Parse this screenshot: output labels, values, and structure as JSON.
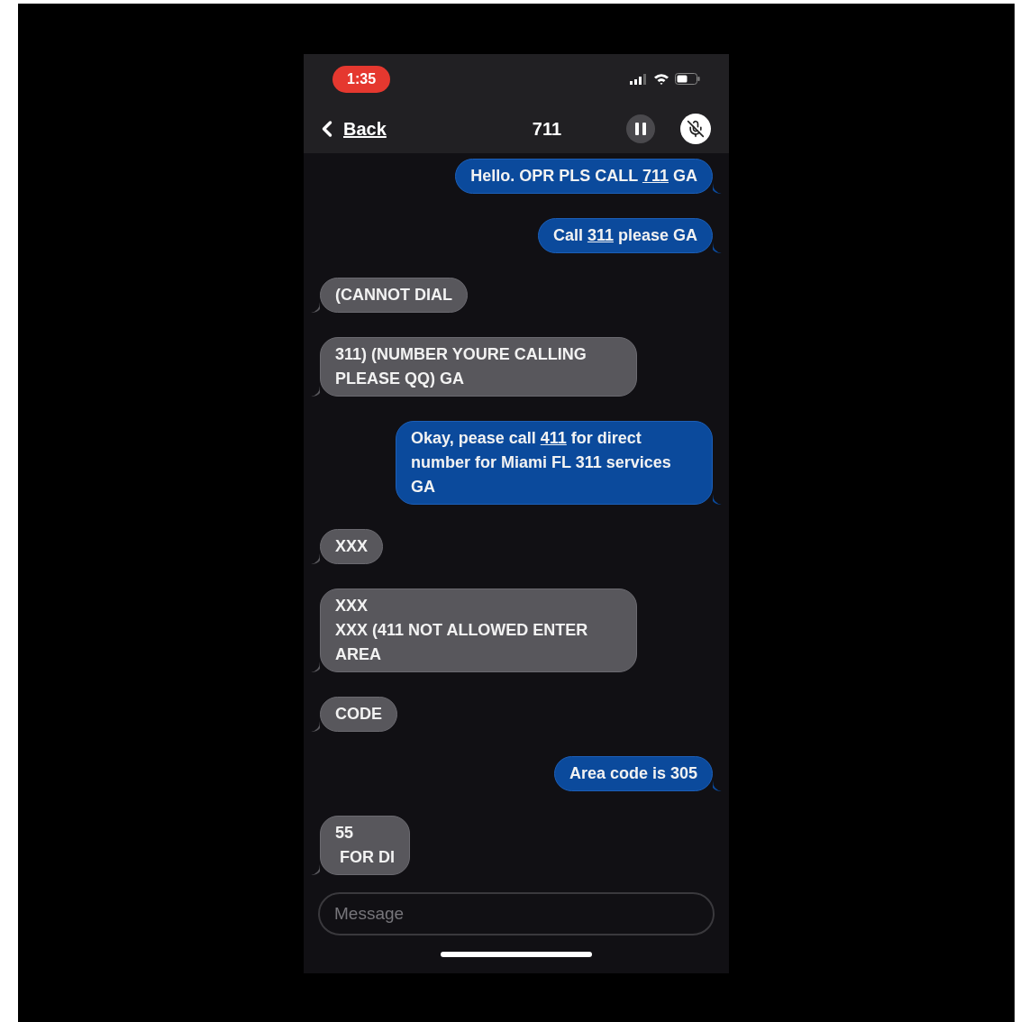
{
  "status_bar": {
    "time": "1:35"
  },
  "nav": {
    "back": "Back",
    "title": "711"
  },
  "messages": [
    {
      "kind": "sent",
      "parts": [
        {
          "text": "Hello. OPR PLS CALL ",
          "link": false
        },
        {
          "text": "711",
          "link": true
        },
        {
          "text": " GA",
          "link": false
        }
      ]
    },
    {
      "kind": "sent",
      "parts": [
        {
          "text": "Call ",
          "link": false
        },
        {
          "text": "311",
          "link": true
        },
        {
          "text": " please GA",
          "link": false
        }
      ]
    },
    {
      "kind": "received",
      "parts": [
        {
          "text": "(CANNOT DIAL",
          "link": false
        }
      ]
    },
    {
      "kind": "received",
      "parts": [
        {
          "text": "311) (NUMBER YOURE CALLING PLEASE QQ) GA",
          "link": false
        }
      ]
    },
    {
      "kind": "sent",
      "parts": [
        {
          "text": "Okay, pease call ",
          "link": false
        },
        {
          "text": "411",
          "link": true
        },
        {
          "text": " for direct number for Miami FL 311 services GA",
          "link": false
        }
      ]
    },
    {
      "kind": "received",
      "parts": [
        {
          "text": "XXX",
          "link": false
        }
      ]
    },
    {
      "kind": "received",
      "parts": [
        {
          "text": "XXX\nXXX (411 NOT ALLOWED ENTER AREA",
          "link": false
        }
      ]
    },
    {
      "kind": "received",
      "parts": [
        {
          "text": "CODE",
          "link": false
        }
      ]
    },
    {
      "kind": "sent",
      "parts": [
        {
          "text": "Area code is 305",
          "link": false
        }
      ]
    },
    {
      "kind": "received",
      "parts": [
        {
          "text": "55\n FOR DI",
          "link": false
        }
      ]
    }
  ],
  "composer": {
    "placeholder": "Message"
  }
}
